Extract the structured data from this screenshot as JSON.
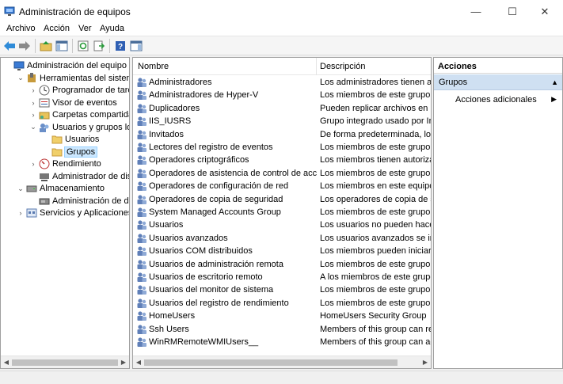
{
  "window": {
    "title": "Administración de equipos",
    "minimize": "—",
    "maximize": "☐",
    "close": "✕"
  },
  "menu": [
    "Archivo",
    "Acción",
    "Ver",
    "Ayuda"
  ],
  "tree": [
    {
      "label": "Administración del equipo (loca",
      "exp": "",
      "icon": "computer-management-icon",
      "indent": 0,
      "selected": false
    },
    {
      "label": "Herramientas del sistema",
      "exp": "⌄",
      "icon": "system-tools-icon",
      "indent": 1,
      "selected": false
    },
    {
      "label": "Programador de tareas",
      "exp": "›",
      "icon": "task-scheduler-icon",
      "indent": 2,
      "selected": false
    },
    {
      "label": "Visor de eventos",
      "exp": "›",
      "icon": "event-viewer-icon",
      "indent": 2,
      "selected": false
    },
    {
      "label": "Carpetas compartidas",
      "exp": "›",
      "icon": "shared-folders-icon",
      "indent": 2,
      "selected": false
    },
    {
      "label": "Usuarios y grupos locale",
      "exp": "⌄",
      "icon": "users-groups-icon",
      "indent": 2,
      "selected": false
    },
    {
      "label": "Usuarios",
      "exp": "",
      "icon": "folder-icon",
      "indent": 3,
      "selected": false
    },
    {
      "label": "Grupos",
      "exp": "",
      "icon": "folder-icon",
      "indent": 3,
      "selected": true
    },
    {
      "label": "Rendimiento",
      "exp": "›",
      "icon": "performance-icon",
      "indent": 2,
      "selected": false
    },
    {
      "label": "Administrador de dispos",
      "exp": "",
      "icon": "device-manager-icon",
      "indent": 2,
      "selected": false
    },
    {
      "label": "Almacenamiento",
      "exp": "⌄",
      "icon": "storage-icon",
      "indent": 1,
      "selected": false
    },
    {
      "label": "Administración de disco",
      "exp": "",
      "icon": "disk-management-icon",
      "indent": 2,
      "selected": false
    },
    {
      "label": "Servicios y Aplicaciones",
      "exp": "›",
      "icon": "services-apps-icon",
      "indent": 1,
      "selected": false
    }
  ],
  "list": {
    "columns": [
      "Nombre",
      "Descripción"
    ],
    "rows": [
      {
        "name": "Administradores",
        "desc": "Los administradores tienen acc"
      },
      {
        "name": "Administradores de Hyper-V",
        "desc": "Los miembros de este grupo tie"
      },
      {
        "name": "Duplicadores",
        "desc": "Pueden replicar archivos en un"
      },
      {
        "name": "IIS_IUSRS",
        "desc": "Grupo integrado usado por Int"
      },
      {
        "name": "Invitados",
        "desc": "De forma predeterminada, los i"
      },
      {
        "name": "Lectores del registro de eventos",
        "desc": "Los miembros de este grupo pu"
      },
      {
        "name": "Operadores criptográficos",
        "desc": "Los miembros tienen autorizaci"
      },
      {
        "name": "Operadores de asistencia de control de acceso",
        "desc": "Los miembros de este grupo pu"
      },
      {
        "name": "Operadores de configuración de red",
        "desc": "Los miembros en este equipo p"
      },
      {
        "name": "Operadores de copia de seguridad",
        "desc": "Los operadores de copia de seg"
      },
      {
        "name": "System Managed Accounts Group",
        "desc": "Los miembros de este grupo lo"
      },
      {
        "name": "Usuarios",
        "desc": "Los usuarios no pueden hacer c"
      },
      {
        "name": "Usuarios avanzados",
        "desc": "Los usuarios avanzados se inclu"
      },
      {
        "name": "Usuarios COM distribuidos",
        "desc": "Los miembros pueden iniciar, a"
      },
      {
        "name": "Usuarios de administración remota",
        "desc": "Los miembros de este grupo pu"
      },
      {
        "name": "Usuarios de escritorio remoto",
        "desc": "A los miembros de este grupo s"
      },
      {
        "name": "Usuarios del monitor de sistema",
        "desc": "Los miembros de este grupo tie"
      },
      {
        "name": "Usuarios del registro de rendimiento",
        "desc": "Los miembros de este grupo pu"
      },
      {
        "name": "HomeUsers",
        "desc": "HomeUsers Security Group"
      },
      {
        "name": "Ssh Users",
        "desc": "Members of this group can ren"
      },
      {
        "name": "WinRMRemoteWMIUsers__",
        "desc": "Members of this group can acc"
      }
    ]
  },
  "actions": {
    "header": "Acciones",
    "group": "Grupos",
    "item": "Acciones adicionales"
  },
  "colors": {
    "selection": "#cce8ff",
    "actions_group_bg": "#cfe0f2"
  }
}
